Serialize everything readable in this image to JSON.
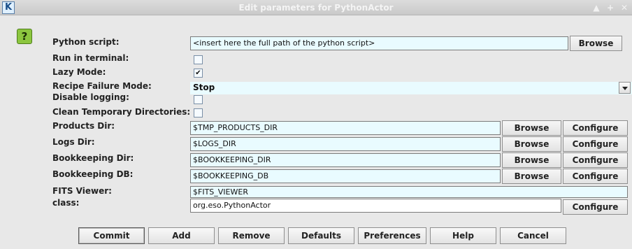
{
  "window": {
    "title": "Edit parameters for PythonActor",
    "app_icon_letter": "K",
    "controls": [
      "▲",
      "+",
      "✕"
    ]
  },
  "help_badge": "?",
  "params": {
    "python_script": {
      "label": "Python script:",
      "value": "<insert here the full path of the python script>",
      "browse": "Browse"
    },
    "run_in_terminal": {
      "label": "Run in terminal:",
      "checked": false
    },
    "lazy_mode": {
      "label": "Lazy Mode:",
      "checked": true,
      "mark": "✔"
    },
    "recipe_failure_mode": {
      "label": "Recipe Failure Mode:",
      "value": "Stop"
    },
    "disable_logging": {
      "label": "Disable logging:",
      "checked": false
    },
    "clean_temp_dirs": {
      "label": "Clean Temporary Directories:",
      "checked": false
    },
    "products_dir": {
      "label": "Products Dir:",
      "value": "$TMP_PRODUCTS_DIR",
      "browse": "Browse",
      "configure": "Configure"
    },
    "logs_dir": {
      "label": "Logs Dir:",
      "value": "$LOGS_DIR",
      "browse": "Browse",
      "configure": "Configure"
    },
    "bookkeeping_dir": {
      "label": "Bookkeeping Dir:",
      "value": "$BOOKKEEPING_DIR",
      "browse": "Browse",
      "configure": "Configure"
    },
    "bookkeeping_db": {
      "label": "Bookkeeping DB:",
      "value": "$BOOKKEEPING_DB",
      "browse": "Browse",
      "configure": "Configure"
    },
    "fits_viewer": {
      "label": "FITS Viewer:",
      "value": "$FITS_VIEWER"
    },
    "class": {
      "label": "class:",
      "value": "org.eso.PythonActor",
      "configure": "Configure"
    }
  },
  "buttons": {
    "commit": "Commit",
    "add": "Add",
    "remove": "Remove",
    "defaults": "Defaults",
    "preferences": "Preferences",
    "help": "Help",
    "cancel": "Cancel"
  },
  "colors": {
    "field_bg": "#e9fbff",
    "help_badge": "#8cc63f"
  }
}
